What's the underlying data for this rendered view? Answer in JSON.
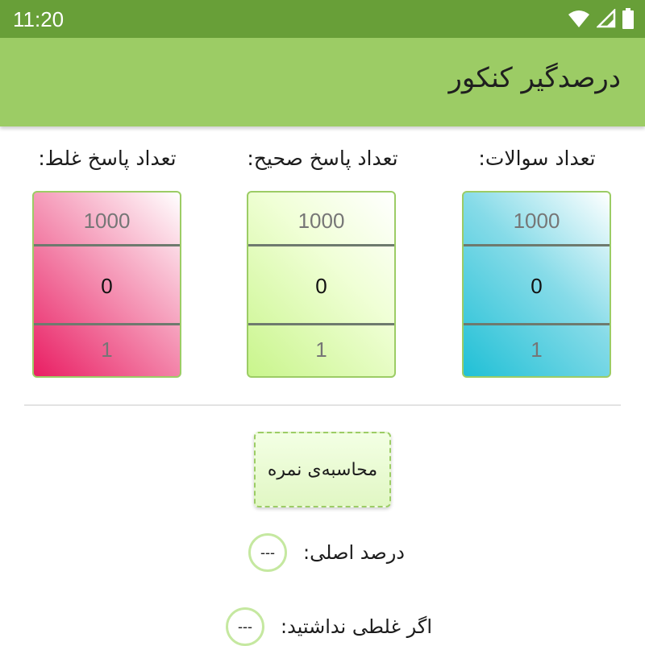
{
  "status_bar": {
    "time": "11:20",
    "icons": [
      "wifi-icon",
      "cell-signal-icon",
      "battery-icon"
    ]
  },
  "app_bar": {
    "title": "درصدگیر کنکور"
  },
  "pickers": [
    {
      "label": "تعداد سوالات:",
      "above": "1000",
      "value": "0",
      "below": "1"
    },
    {
      "label": "تعداد پاسخ صحیح:",
      "above": "1000",
      "value": "0",
      "below": "1"
    },
    {
      "label": "تعداد پاسخ غلط:",
      "above": "1000",
      "value": "0",
      "below": "1"
    }
  ],
  "calculate_button": {
    "label": "محاسبه‌ی نمره"
  },
  "results": {
    "raw_percent": {
      "label": "درصد اصلی:",
      "value": "---"
    },
    "no_wrong": {
      "label": "اگر غلطی نداشتید:",
      "value": "---"
    }
  },
  "colors": {
    "status_bar": "#689f38",
    "app_bar": "#9ccc65",
    "questions_picker": "#20c0d6",
    "correct_picker": "#c9f58c",
    "wrong_picker": "#e91e63"
  }
}
